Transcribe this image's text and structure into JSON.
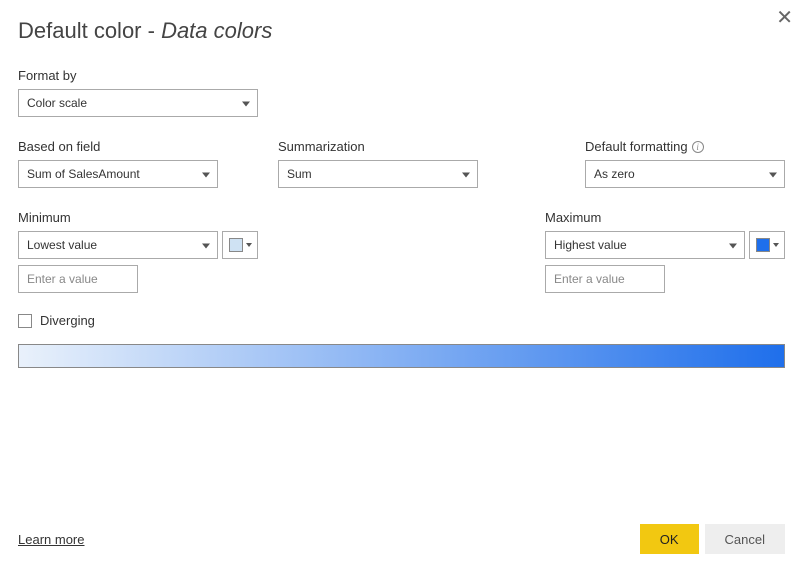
{
  "title": {
    "prefix": "Default color - ",
    "italic": "Data colors"
  },
  "formatBy": {
    "label": "Format by",
    "value": "Color scale"
  },
  "basedOnField": {
    "label": "Based on field",
    "value": "Sum of SalesAmount"
  },
  "summarization": {
    "label": "Summarization",
    "value": "Sum"
  },
  "defaultFormatting": {
    "label": "Default formatting",
    "value": "As zero"
  },
  "minimum": {
    "label": "Minimum",
    "value": "Lowest value",
    "placeholder": "Enter a value",
    "swatch": "#cfe2f3"
  },
  "maximum": {
    "label": "Maximum",
    "value": "Highest value",
    "placeholder": "Enter a value",
    "swatch": "#1f6feb"
  },
  "diverging": {
    "label": "Diverging",
    "checked": false
  },
  "gradient": {
    "start": "#e9f1fb",
    "end": "#1f6feb"
  },
  "footer": {
    "learnMore": "Learn more",
    "ok": "OK",
    "cancel": "Cancel"
  }
}
